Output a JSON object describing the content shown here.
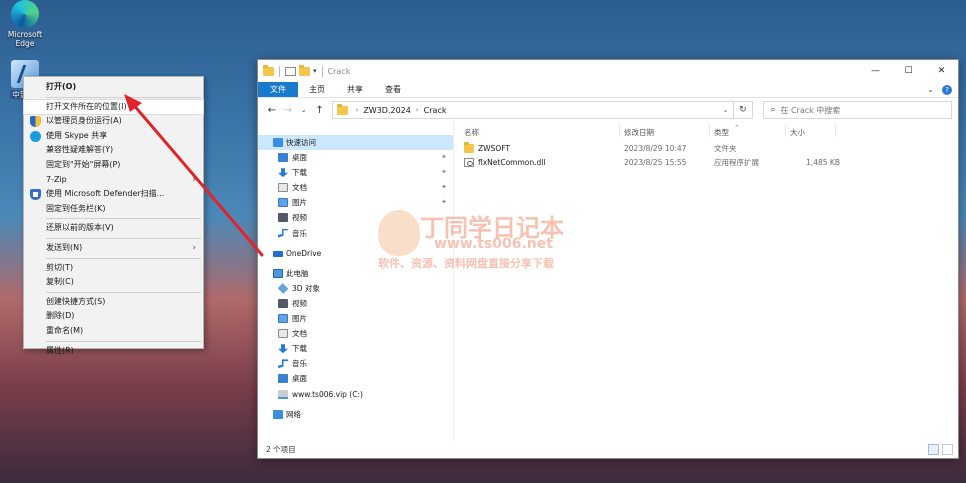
{
  "desktop": {
    "icons": [
      {
        "label": "Microsoft Edge"
      },
      {
        "label": "中望3D"
      }
    ]
  },
  "context_menu": {
    "items": [
      {
        "label": "打开(O)",
        "bold": true
      },
      {
        "label": "打开文件所在的位置(I)",
        "highlight": true
      },
      {
        "label": "以管理员身份运行(A)",
        "icon": "shield-icon"
      },
      {
        "label": "使用 Skype 共享",
        "icon": "skype-icon"
      },
      {
        "label": "兼容性疑难解答(Y)"
      },
      {
        "label": "固定到\"开始\"屏幕(P)"
      },
      {
        "label": "7-Zip",
        "submenu": true
      },
      {
        "label": "使用 Microsoft Defender扫描...",
        "icon": "defender-icon"
      },
      {
        "label": "固定到任务栏(K)"
      },
      {
        "label": "还原以前的版本(V)"
      },
      {
        "label": "发送到(N)",
        "submenu": true
      },
      {
        "label": "剪切(T)"
      },
      {
        "label": "复制(C)"
      },
      {
        "label": "创建快捷方式(S)"
      },
      {
        "label": "删除(D)"
      },
      {
        "label": "重命名(M)"
      },
      {
        "label": "属性(R)"
      }
    ]
  },
  "explorer": {
    "title": "Crack",
    "ribbon_tabs": [
      "文件",
      "主页",
      "共享",
      "查看"
    ],
    "address": [
      "ZW3D.2024",
      "Crack"
    ],
    "search_placeholder": "在 Crack 中搜索",
    "nav_items": [
      {
        "label": "快速访问",
        "icon": "c-star",
        "level": 0,
        "selected": true
      },
      {
        "label": "桌面",
        "icon": "c-desk",
        "level": 1,
        "pinned": true
      },
      {
        "label": "下载",
        "icon": "c-down",
        "level": 1,
        "pinned": true
      },
      {
        "label": "文档",
        "icon": "c-doc",
        "level": 1,
        "pinned": true
      },
      {
        "label": "图片",
        "icon": "c-pic",
        "level": 1,
        "pinned": true
      },
      {
        "label": "视频",
        "icon": "c-vid",
        "level": 1
      },
      {
        "label": "音乐",
        "icon": "c-mus",
        "level": 1
      },
      {
        "gap": true
      },
      {
        "label": "OneDrive",
        "icon": "c-cloud",
        "level": 0
      },
      {
        "gap": true
      },
      {
        "label": "此电脑",
        "icon": "c-pc",
        "level": 0
      },
      {
        "label": "3D 对象",
        "icon": "c-3d",
        "level": 1
      },
      {
        "label": "视频",
        "icon": "c-vid",
        "level": 1
      },
      {
        "label": "图片",
        "icon": "c-pic",
        "level": 1
      },
      {
        "label": "文档",
        "icon": "c-doc",
        "level": 1
      },
      {
        "label": "下载",
        "icon": "c-down",
        "level": 1
      },
      {
        "label": "音乐",
        "icon": "c-mus",
        "level": 1
      },
      {
        "label": "桌面",
        "icon": "c-desk",
        "level": 1
      },
      {
        "label": "www.ts006.vip (C:)",
        "icon": "c-drive",
        "level": 1
      },
      {
        "gap": true
      },
      {
        "label": "网络",
        "icon": "c-net",
        "level": 0
      }
    ],
    "columns": [
      "名称",
      "修改日期",
      "类型",
      "大小"
    ],
    "files": [
      {
        "name": "ZWSOFT",
        "date": "2023/8/29 10:47",
        "type": "文件夹",
        "size": "",
        "kind": "folder"
      },
      {
        "name": "flxNetCommon.dll",
        "date": "2023/8/25 15:55",
        "type": "应用程序扩展",
        "size": "1,485 KB",
        "kind": "dll"
      }
    ],
    "status": "2 个项目"
  },
  "watermark": {
    "title": "丁同学日记本",
    "url": "www.ts006.net",
    "subtitle": "软件、资源、资料网盘直接分享下载"
  },
  "colors": {
    "accent": "#1979ca",
    "selection": "#cce8ff",
    "arrow": "#e0242b"
  }
}
